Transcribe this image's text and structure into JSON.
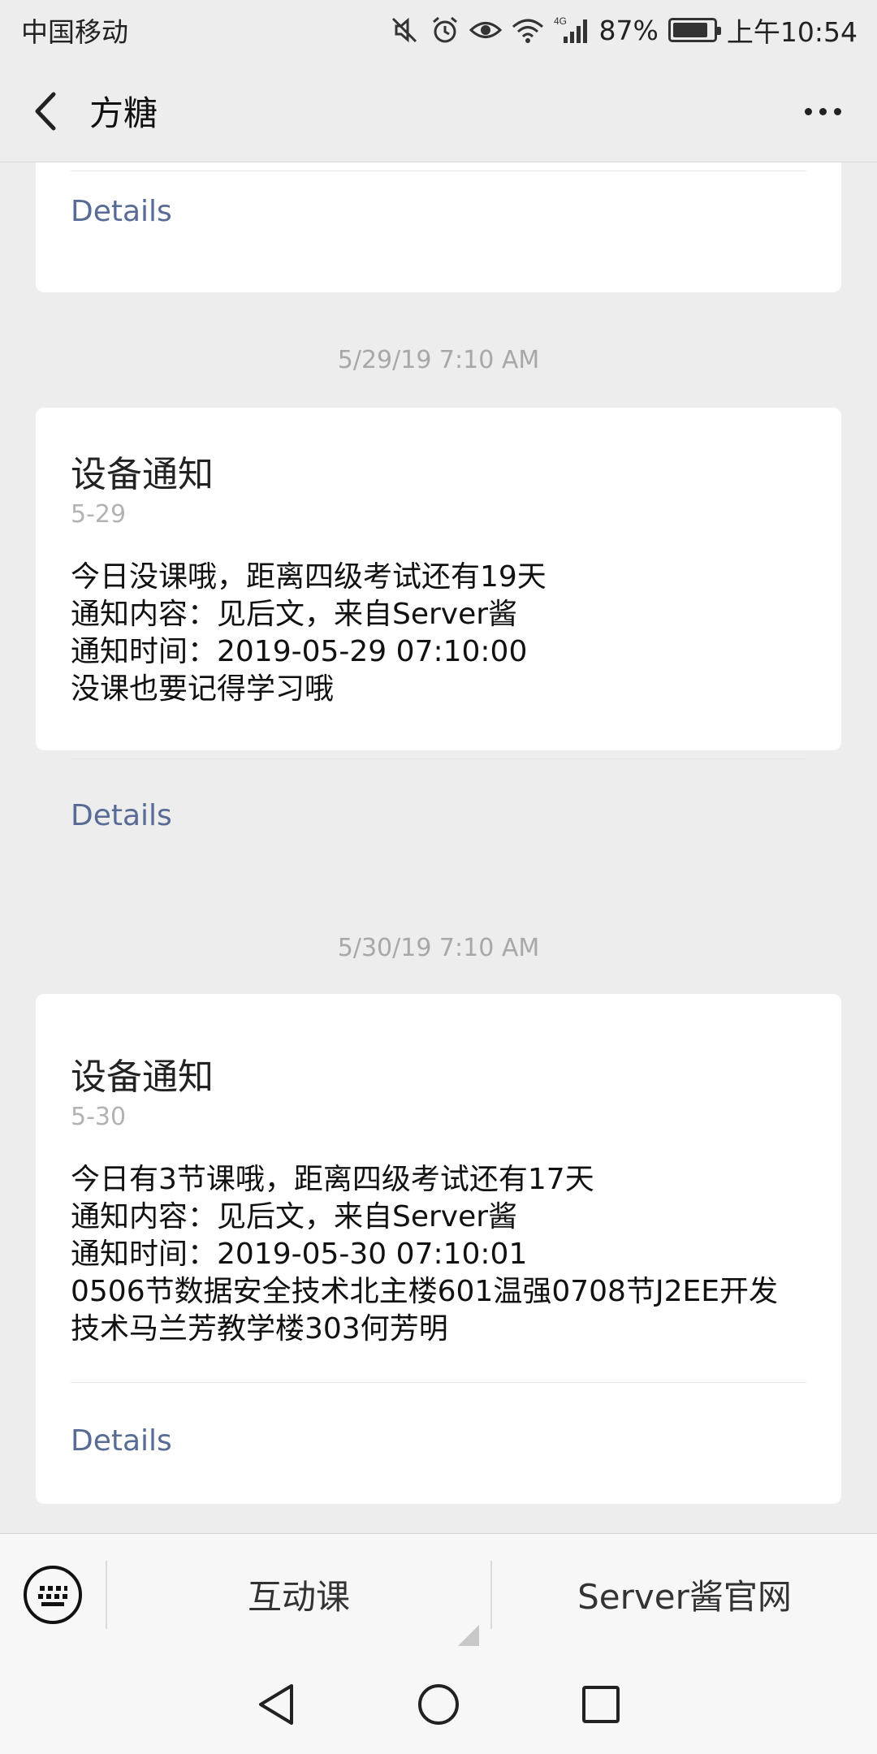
{
  "status_bar": {
    "carrier": "中国移动",
    "battery_percent": "87%",
    "battery_level": 0.87,
    "network": "4G",
    "time": "上午10:54"
  },
  "header": {
    "title": "方糖"
  },
  "messages": [
    {
      "details_label": "Details"
    },
    {
      "timestamp": "5/29/19 7:10 AM",
      "title": "设备通知",
      "date": "5-29",
      "lines": [
        "今日没课哦，距离四级考试还有19天",
        "通知内容：见后文，来自Server酱",
        "通知时间：2019-05-29 07:10:00",
        "没课也要记得学习哦"
      ],
      "details_label": "Details"
    },
    {
      "timestamp": "5/30/19 7:10 AM",
      "title": "设备通知",
      "date": "5-30",
      "lines": [
        "今日有3节课哦，距离四级考试还有17天",
        "通知内容：见后文，来自Server酱",
        "通知时间：2019-05-30 07:10:01",
        "0506节数据安全技术北主楼601温强0708节J2EE开发",
        "技术马兰芳教学楼303何芳明"
      ],
      "details_label": "Details"
    }
  ],
  "bottom_menu": {
    "items": [
      "互动课",
      "Server酱官网"
    ]
  },
  "icons": {
    "status": [
      "mute-icon",
      "alarm-icon",
      "eye-icon",
      "wifi-icon",
      "signal-icon",
      "battery-icon"
    ],
    "header": [
      "back-arrow-icon",
      "more-icon"
    ],
    "menu": [
      "keyboard-icon",
      "submenu-arrow-icon"
    ],
    "nav": [
      "nav-back-icon",
      "nav-home-icon",
      "nav-recents-icon"
    ]
  },
  "colors": {
    "link": "#576b95",
    "background": "#ededed",
    "card": "#ffffff"
  }
}
